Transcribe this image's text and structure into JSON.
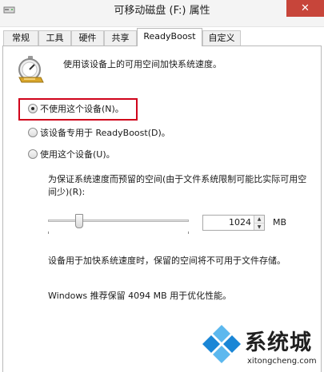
{
  "window": {
    "title": "可移动磁盘 (F:) 属性",
    "close_glyph": "✕"
  },
  "tabs": [
    {
      "label": "常规"
    },
    {
      "label": "工具"
    },
    {
      "label": "硬件"
    },
    {
      "label": "共享"
    },
    {
      "label": "ReadyBoost",
      "active": true
    },
    {
      "label": "自定义"
    }
  ],
  "readyboost": {
    "icon": "readyboost-speedometer-icon",
    "description": "使用该设备上的可用空间加快系统速度。",
    "options": [
      {
        "label": "不使用这个设备(N)。",
        "selected": true
      },
      {
        "label": "该设备专用于 ReadyBoost(D)。",
        "selected": false
      },
      {
        "label": "使用这个设备(U)。",
        "selected": false
      }
    ],
    "reserve_label": "为保证系统速度而预留的空间(由于文件系统限制可能比实际可用空间少)(R):",
    "slider_fraction": 0.22,
    "spin_value": "1024",
    "unit": "MB",
    "note": "设备用于加快系统速度时，保留的空间将不可用于文件存储。",
    "recommendation": "Windows 推荐保留 4094 MB 用于优化性能。"
  },
  "watermark": {
    "brand": "系统城",
    "url": "xitongcheng.com",
    "colors": {
      "blue": "#1a86d6",
      "light_blue": "#5cb8ee"
    }
  },
  "colors": {
    "highlight": "#d0021b",
    "close": "#c7453a"
  }
}
